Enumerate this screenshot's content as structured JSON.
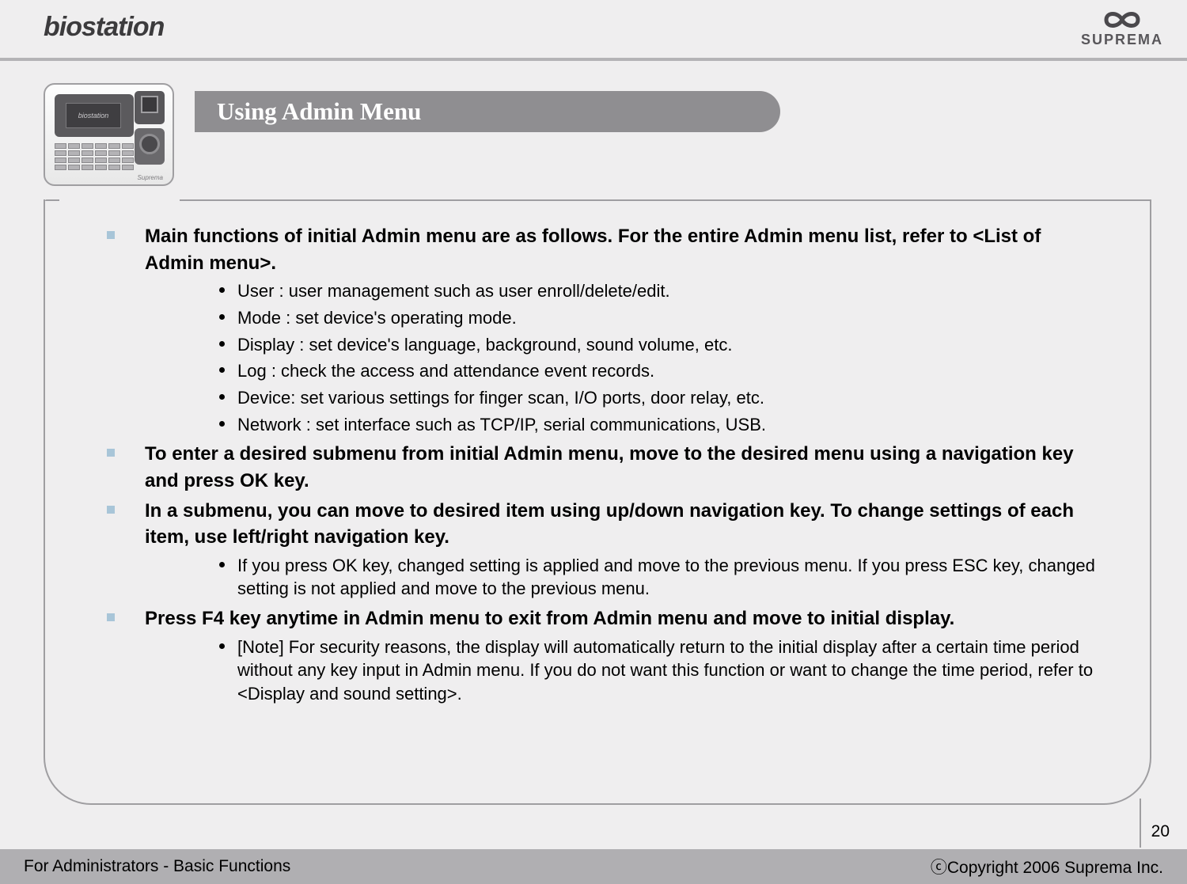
{
  "header": {
    "logo_left_text": "biostation",
    "logo_right_text": "SUPREMA"
  },
  "title": "Using Admin Menu",
  "device_label": "biostation",
  "content": {
    "items": [
      {
        "main": "Main functions of initial Admin menu are as follows. For the entire Admin menu list, refer to <List of Admin menu>.",
        "subs": [
          "User : user management such as user enroll/delete/edit.",
          "Mode : set device's operating mode.",
          "Display : set device's language, background, sound volume, etc.",
          "Log : check the access and attendance event records.",
          "Device: set various settings for finger scan, I/O ports, door relay, etc.",
          "Network : set interface such as TCP/IP, serial communications, USB."
        ]
      },
      {
        "main": "To enter a desired submenu from initial Admin menu, move to the desired menu using a navigation key and press OK key.",
        "subs": []
      },
      {
        "main": "In a submenu, you can move to desired item using up/down navigation key. To change settings of each item, use left/right navigation key.",
        "subs": [
          "If you press OK key, changed setting is applied and move to the previous menu. If you press ESC key, changed setting is not applied and move to the previous menu."
        ]
      },
      {
        "main": "Press F4 key anytime in Admin menu to exit from Admin menu and move to initial display.",
        "subs": [
          "[Note] For security reasons, the display will automatically return to the initial display after a certain time period without any key input in Admin menu. If you do not want this function or want to change the time period, refer to <Display and sound setting>."
        ]
      }
    ]
  },
  "footer": {
    "left": "For Administrators - Basic Functions",
    "right": "ⓒCopyright 2006 Suprema Inc."
  },
  "page_number": "20"
}
